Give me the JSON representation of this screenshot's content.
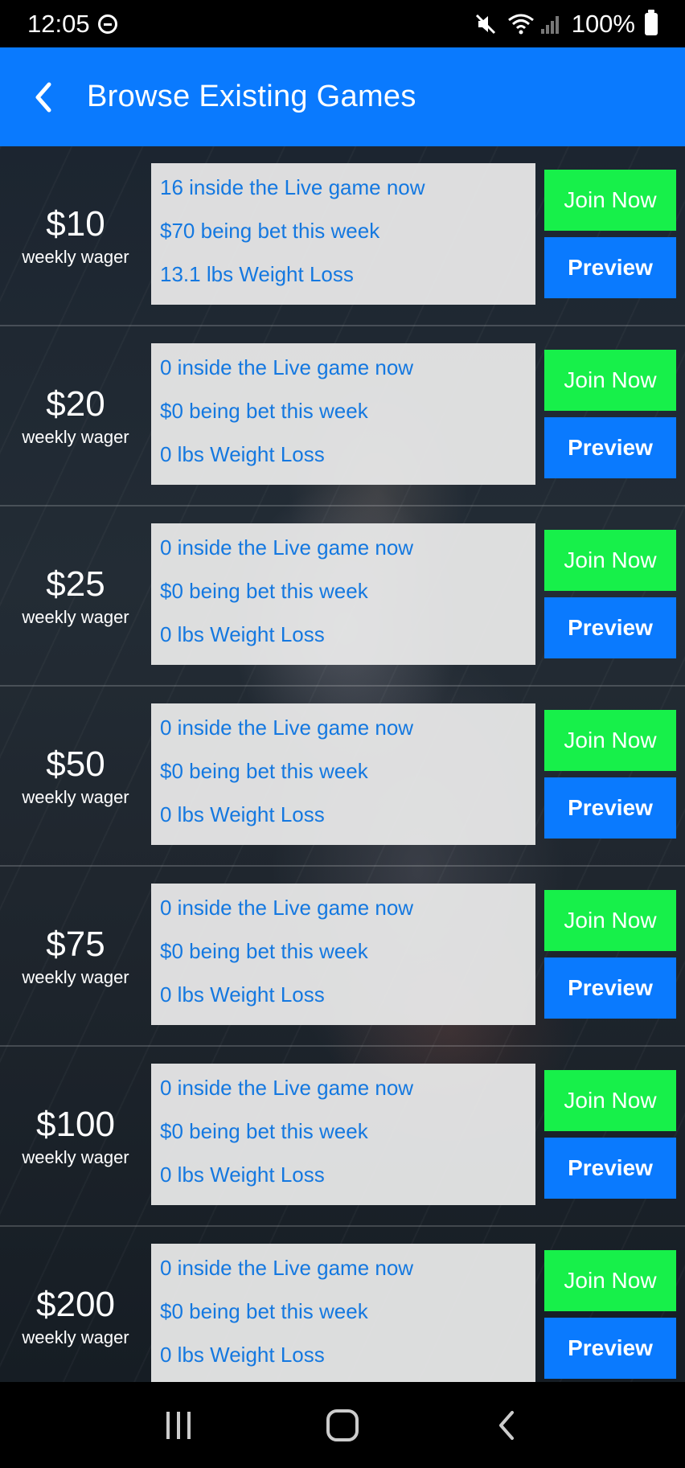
{
  "status_bar": {
    "time": "12:05",
    "battery": "100%",
    "icons": [
      "do-not-disturb-icon",
      "mute-icon",
      "wifi-icon",
      "signal-icon",
      "battery-icon"
    ]
  },
  "app_bar": {
    "title": "Browse Existing Games",
    "back_icon": "chevron-left-icon",
    "color": "#0a7afe"
  },
  "games": [
    {
      "amount": "$10",
      "wager_label": "weekly wager",
      "players": "16 inside the Live game now",
      "bet": "$70 being bet this week",
      "weight_loss": "13.1  lbs Weight Loss",
      "join_label": "Join Now",
      "preview_label": "Preview"
    },
    {
      "amount": "$20",
      "wager_label": "weekly wager",
      "players": "0 inside the Live game now",
      "bet": "$0 being bet this week",
      "weight_loss": "0  lbs Weight Loss",
      "join_label": "Join Now",
      "preview_label": "Preview"
    },
    {
      "amount": "$25",
      "wager_label": "weekly wager",
      "players": "0 inside the Live game now",
      "bet": "$0 being bet this week",
      "weight_loss": "0  lbs Weight Loss",
      "join_label": "Join Now",
      "preview_label": "Preview"
    },
    {
      "amount": "$50",
      "wager_label": "weekly wager",
      "players": "0 inside the Live game now",
      "bet": "$0 being bet this week",
      "weight_loss": "0  lbs Weight Loss",
      "join_label": "Join Now",
      "preview_label": "Preview"
    },
    {
      "amount": "$75",
      "wager_label": "weekly wager",
      "players": "0 inside the Live game now",
      "bet": "$0 being bet this week",
      "weight_loss": "0  lbs Weight Loss",
      "join_label": "Join Now",
      "preview_label": "Preview"
    },
    {
      "amount": "$100",
      "wager_label": "weekly wager",
      "players": "0 inside the Live game now",
      "bet": "$0 being bet this week",
      "weight_loss": "0  lbs Weight Loss",
      "join_label": "Join Now",
      "preview_label": "Preview"
    },
    {
      "amount": "$200",
      "wager_label": "weekly wager",
      "players": "0 inside the Live game now",
      "bet": "$0 being bet this week",
      "weight_loss": "0  lbs Weight Loss",
      "join_label": "Join Now",
      "preview_label": "Preview"
    }
  ],
  "colors": {
    "join_button": "#17f04a",
    "preview_button": "#0a7afe",
    "stat_text": "#1478e0"
  },
  "nav_bar": {
    "icons": [
      "recent-apps-icon",
      "home-icon",
      "back-icon"
    ]
  }
}
